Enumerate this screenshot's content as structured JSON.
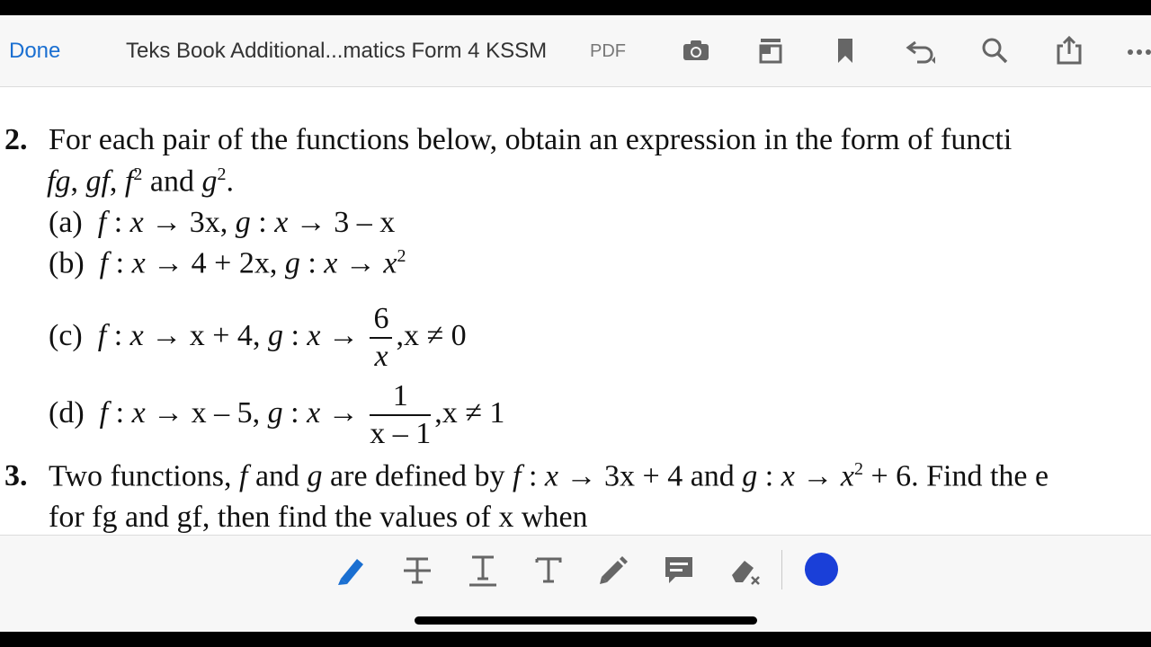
{
  "toolbar": {
    "done_label": "Done",
    "title": "Teks Book Additional...matics Form 4 KSSM",
    "doc_type": "PDF",
    "icons": [
      "camera-icon",
      "page-layout-icon",
      "bookmark-icon",
      "undo-icon",
      "search-icon",
      "share-icon",
      "more-icon"
    ]
  },
  "content": {
    "q2": {
      "number": "2.",
      "line1": "For each pair of the functions below, obtain an expression in the form of functi",
      "line2_a": "fg",
      "line2_b": "gf",
      "line2_c": "f",
      "line2_and": "and",
      "line2_d": "g",
      "sup2": "2",
      "parts": [
        {
          "label": "(a)",
          "f": "3x",
          "g": "3 – x"
        },
        {
          "label": "(b)",
          "f": "4 + 2x",
          "g": "x"
        },
        {
          "label": "(c)",
          "f": "x + 4",
          "g_num": "6",
          "g_den": "x",
          "cond": "x ≠ 0"
        },
        {
          "label": "(d)",
          "f": "x – 5",
          "g_num": "1",
          "g_den": "x – 1",
          "cond": "x ≠ 1"
        }
      ]
    },
    "q3": {
      "number": "3.",
      "line1_a": "Two functions,",
      "line1_b": "and",
      "line1_c": "are defined by",
      "line1_d": "3x + 4",
      "line1_e": "x",
      "line1_f": "+ 6. Find the e",
      "line2": "for fg and gf, then find the values of x when"
    }
  },
  "annotation_bar": {
    "tools": [
      "highlight-pen-icon",
      "strikethrough-icon",
      "underline-icon",
      "text-icon",
      "pencil-icon",
      "comment-icon",
      "eraser-icon"
    ],
    "active_tool": "highlight-pen-icon",
    "active_color": "#1a3fd8",
    "ink_color": "#1a3fd8"
  },
  "colors": {
    "link_blue": "#1a6fd1",
    "icon_gray": "#666666"
  }
}
